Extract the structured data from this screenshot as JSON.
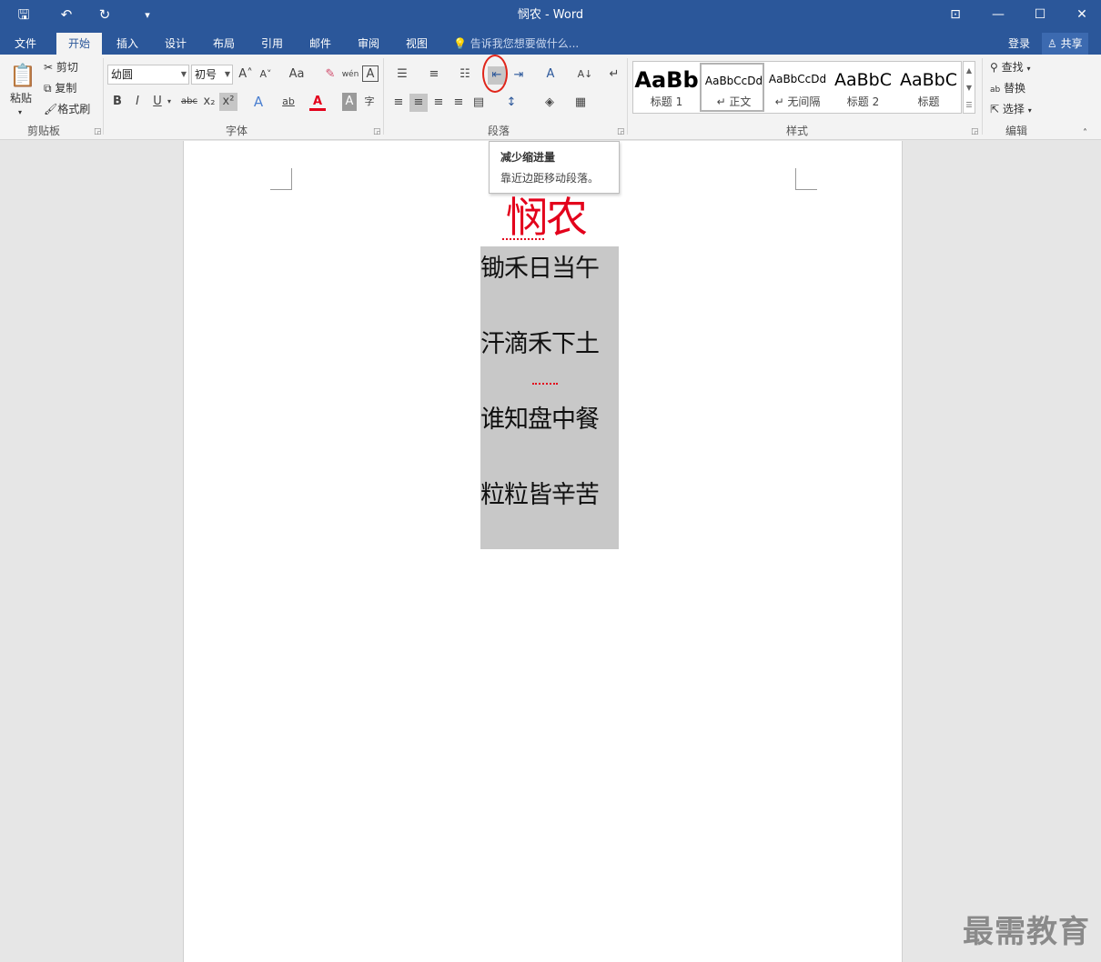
{
  "titlebar": {
    "title": "悯农 - Word",
    "save_icon": "save-icon",
    "undo_icon": "undo-icon",
    "redo_icon": "redo-icon",
    "customize_icon": "customize-quick-access-icon",
    "glyph_save": "🖫",
    "glyph_undo": "↶",
    "glyph_redo": "↻",
    "glyph_customize": "▾",
    "glyph_ribbon_display": "⊡",
    "glyph_minimize": "—",
    "glyph_maximize": "☐",
    "glyph_close": "✕",
    "bg_color": "#2b579a"
  },
  "tabs": [
    {
      "label": "文件"
    },
    {
      "label": "开始"
    },
    {
      "label": "插入"
    },
    {
      "label": "设计"
    },
    {
      "label": "布局"
    },
    {
      "label": "引用"
    },
    {
      "label": "邮件"
    },
    {
      "label": "审阅"
    },
    {
      "label": "视图"
    }
  ],
  "active_tab": "开始",
  "tell_me": {
    "placeholder": "告诉我您想要做什么...",
    "glyph": "💡"
  },
  "account": {
    "login": "登录",
    "share": "共享"
  },
  "clipboard": {
    "label": "剪贴板",
    "paste": "粘贴",
    "cut": "剪切",
    "copy": "复制",
    "format_painter": "格式刷"
  },
  "font": {
    "label": "字体",
    "font_name": "幼圆",
    "font_size": "初号",
    "grow_glyph": "A˄",
    "shrink_glyph": "A˅",
    "change_case_glyph": "Aa",
    "clear_glyph": "✎",
    "phonetic_glyph": "wén",
    "border_glyph": "A",
    "bold": "B",
    "italic": "I",
    "underline": "U",
    "strike": "abc",
    "subscript": "x₂",
    "superscript": "x²",
    "text_effects": "A",
    "highlight": "ab",
    "font_color": "A",
    "shading": "A",
    "enclose": "字"
  },
  "paragraph": {
    "label": "段落",
    "bullets_glyph": "☰",
    "numbering_glyph": "≡",
    "multilevel_glyph": "☷",
    "decrease_indent_glyph": "⇤",
    "increase_indent_glyph": "⇥",
    "chinese_layout_glyph": "A",
    "sort_glyph": "A↓",
    "marks_glyph": "↵",
    "align_left_glyph": "≡",
    "center_glyph": "≡",
    "align_right_glyph": "≡",
    "justify_glyph": "≡",
    "distributed_glyph": "▤",
    "line_spacing_glyph": "↕",
    "shading_glyph": "◈",
    "borders_glyph": "▦"
  },
  "styles": {
    "label": "样式",
    "items": [
      {
        "sample": "AaBb",
        "name": "标题 1"
      },
      {
        "sample": "AaBbCcDd",
        "name": "↵ 正文"
      },
      {
        "sample": "AaBbCcDd",
        "name": "↵ 无间隔"
      },
      {
        "sample": "AaBbC",
        "name": "标题 2"
      },
      {
        "sample": "AaBbC",
        "name": "标题"
      }
    ]
  },
  "editing": {
    "label": "编辑",
    "find": "查找",
    "replace": "替换",
    "select": "选择"
  },
  "tooltip": {
    "title": "减少缩进量",
    "desc": "靠近边距移动段落。"
  },
  "document": {
    "title": "悯农",
    "title_color": "#e3001b",
    "lines": [
      "锄禾日当午",
      "汗滴禾下土",
      "谁知盘中餐",
      "粒粒皆辛苦"
    ]
  },
  "watermark": "最需教育"
}
